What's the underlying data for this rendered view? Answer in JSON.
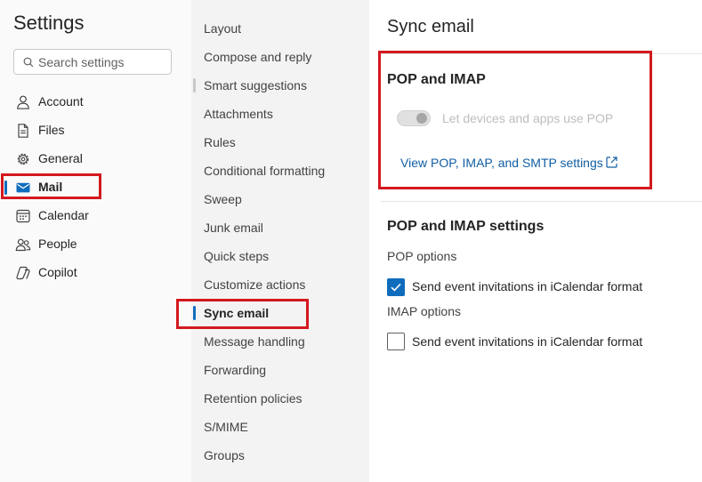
{
  "sidebar": {
    "title": "Settings",
    "search_placeholder": "Search settings",
    "items": [
      {
        "label": "Account",
        "icon": "person-icon"
      },
      {
        "label": "Files",
        "icon": "document-icon"
      },
      {
        "label": "General",
        "icon": "gear-icon"
      },
      {
        "label": "Mail",
        "icon": "mail-icon",
        "selected": true
      },
      {
        "label": "Calendar",
        "icon": "calendar-icon"
      },
      {
        "label": "People",
        "icon": "people-icon"
      },
      {
        "label": "Copilot",
        "icon": "copilot-icon"
      }
    ]
  },
  "mail_nav": {
    "items": [
      {
        "label": "Layout"
      },
      {
        "label": "Compose and reply"
      },
      {
        "label": "Smart suggestions"
      },
      {
        "label": "Attachments"
      },
      {
        "label": "Rules"
      },
      {
        "label": "Conditional formatting"
      },
      {
        "label": "Sweep"
      },
      {
        "label": "Junk email"
      },
      {
        "label": "Quick steps"
      },
      {
        "label": "Customize actions"
      },
      {
        "label": "Sync email",
        "selected": true
      },
      {
        "label": "Message handling"
      },
      {
        "label": "Forwarding"
      },
      {
        "label": "Retention policies"
      },
      {
        "label": "S/MIME"
      },
      {
        "label": "Groups"
      }
    ]
  },
  "content": {
    "title": "Sync email",
    "pop_imap": {
      "heading": "POP and IMAP",
      "toggle_label": "Let devices and apps use POP",
      "toggle_state": "on (disabled)",
      "link_text": "View POP, IMAP, and SMTP settings",
      "link_icon": "open-external-icon"
    },
    "settings": {
      "heading": "POP and IMAP settings",
      "pop_options_label": "POP options",
      "pop_checkbox_label": "Send event invitations in iCalendar format",
      "pop_checkbox_checked": true,
      "imap_options_label": "IMAP options",
      "imap_checkbox_label": "Send event invitations in iCalendar format",
      "imap_checkbox_checked": false
    }
  },
  "colors": {
    "accent": "#0f6cbd",
    "link": "#115ea3",
    "highlight": "#d3191f"
  }
}
